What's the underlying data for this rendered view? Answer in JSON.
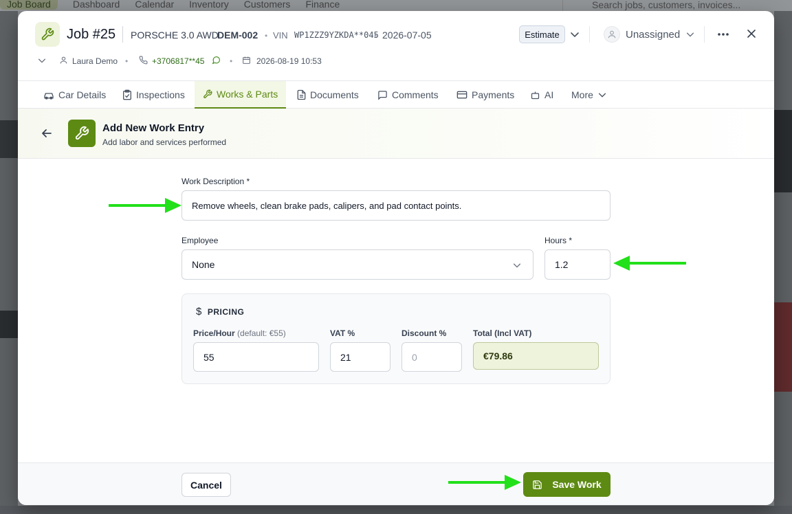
{
  "background": {
    "nav": [
      "Job Board",
      "Dashboard",
      "Calendar",
      "Inventory",
      "Customers",
      "Finance"
    ],
    "search_placeholder": "Search jobs, customers, invoices..."
  },
  "header": {
    "job_title": "Job #25",
    "car_model": "PORSCHE 3.0 AWD",
    "plate": "DEM-002",
    "vin_label": "VIN",
    "vin_value": "WP1ZZZ9YZKDA**045",
    "job_date": "2026-07-05",
    "status_label": "Estimate",
    "assignee": "Unassigned",
    "customer_name": "Laura Demo",
    "phone": "+3706817**45",
    "appointment": "2026-08-19 10:53"
  },
  "tabs": [
    {
      "label": "Car Details",
      "icon": "car-icon"
    },
    {
      "label": "Inspections",
      "icon": "clipboard-check-icon"
    },
    {
      "label": "Works & Parts",
      "icon": "wrench-icon",
      "active": true
    },
    {
      "label": "Documents",
      "icon": "document-icon"
    },
    {
      "label": "Comments",
      "icon": "comment-icon"
    },
    {
      "label": "Payments",
      "icon": "credit-card-icon"
    },
    {
      "label": "AI",
      "icon": "robot-icon"
    },
    {
      "label": "More",
      "icon": "chevron-down-icon"
    }
  ],
  "form": {
    "title": "Add New Work Entry",
    "subtitle": "Add labor and services performed",
    "description_label": "Work Description *",
    "description_value": "Remove wheels, clean brake pads, calipers, and pad contact points.",
    "employee_label": "Employee",
    "employee_value": "None",
    "hours_label": "Hours *",
    "hours_value": "1.2"
  },
  "pricing": {
    "title": "PRICING",
    "price_label": "Price/Hour",
    "price_hint": "(default: €55)",
    "price_value": "55",
    "vat_label": "VAT %",
    "vat_value": "21",
    "discount_label": "Discount %",
    "discount_placeholder": "0",
    "total_label": "Total (Incl VAT)",
    "total_value": "€79.86"
  },
  "footer": {
    "cancel_label": "Cancel",
    "save_label": "Save Work"
  },
  "colors": {
    "accent": "#5d8a13",
    "annotation_arrow": "#22e01a"
  }
}
